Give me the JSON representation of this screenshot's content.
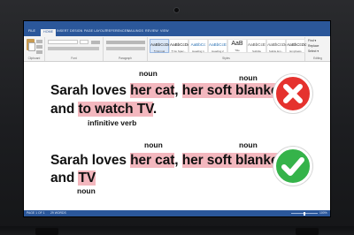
{
  "ribbon": {
    "tabs": [
      "FILE",
      "HOME",
      "INSERT",
      "DESIGN",
      "PAGE LAYOUT",
      "REFERENCES",
      "MAILINGS",
      "REVIEW",
      "VIEW"
    ],
    "groups": [
      "Clipboard",
      "Font",
      "Paragraph",
      "Styles",
      "Editing"
    ],
    "styles": [
      {
        "sample": "AaBbCcDc",
        "name": "¶ Normal"
      },
      {
        "sample": "AaBbCcDc",
        "name": "¶ No Spac..."
      },
      {
        "sample": "AaBbCc",
        "name": "Heading 1"
      },
      {
        "sample": "AaBbCcE",
        "name": "Heading 2"
      },
      {
        "sample": "AaB",
        "name": "Title"
      },
      {
        "sample": "AaBbCcE",
        "name": "Subtitle"
      },
      {
        "sample": "AaBbCcDc",
        "name": "Subtle Em..."
      },
      {
        "sample": "AaBbCcDc",
        "name": "Emphasis"
      }
    ],
    "editing": [
      "Find ▾",
      "Replace",
      "Select ▾"
    ]
  },
  "sentence1": {
    "noun_label_1": "noun",
    "noun_label_2": "noun",
    "line1_start": "Sarah loves ",
    "phrase_a": "her cat",
    "comma": ",",
    "space": " ",
    "phrase_b": "her soft blanket",
    "trail": ",",
    "line2_start": "and ",
    "phrase_c": "to watch TV",
    "period": ".",
    "infinitive_label": "infinitive verb"
  },
  "sentence2": {
    "noun_label_1": "noun",
    "noun_label_2": "noun",
    "line1_start": "Sarah loves ",
    "phrase_a": "her cat",
    "comma": ",",
    "space": " ",
    "phrase_b": "her soft blanket",
    "trail": ",",
    "line2_start": "and ",
    "phrase_c": "TV",
    "noun_label_3": "noun"
  },
  "status": {
    "page": "PAGE 1 OF 1",
    "words": "29 WORDS",
    "zoom": "100%"
  },
  "colors": {
    "ribbon_blue": "#2b579a",
    "highlight": "#f3b7be",
    "wrong": "#e5322e",
    "right": "#35b34a"
  }
}
